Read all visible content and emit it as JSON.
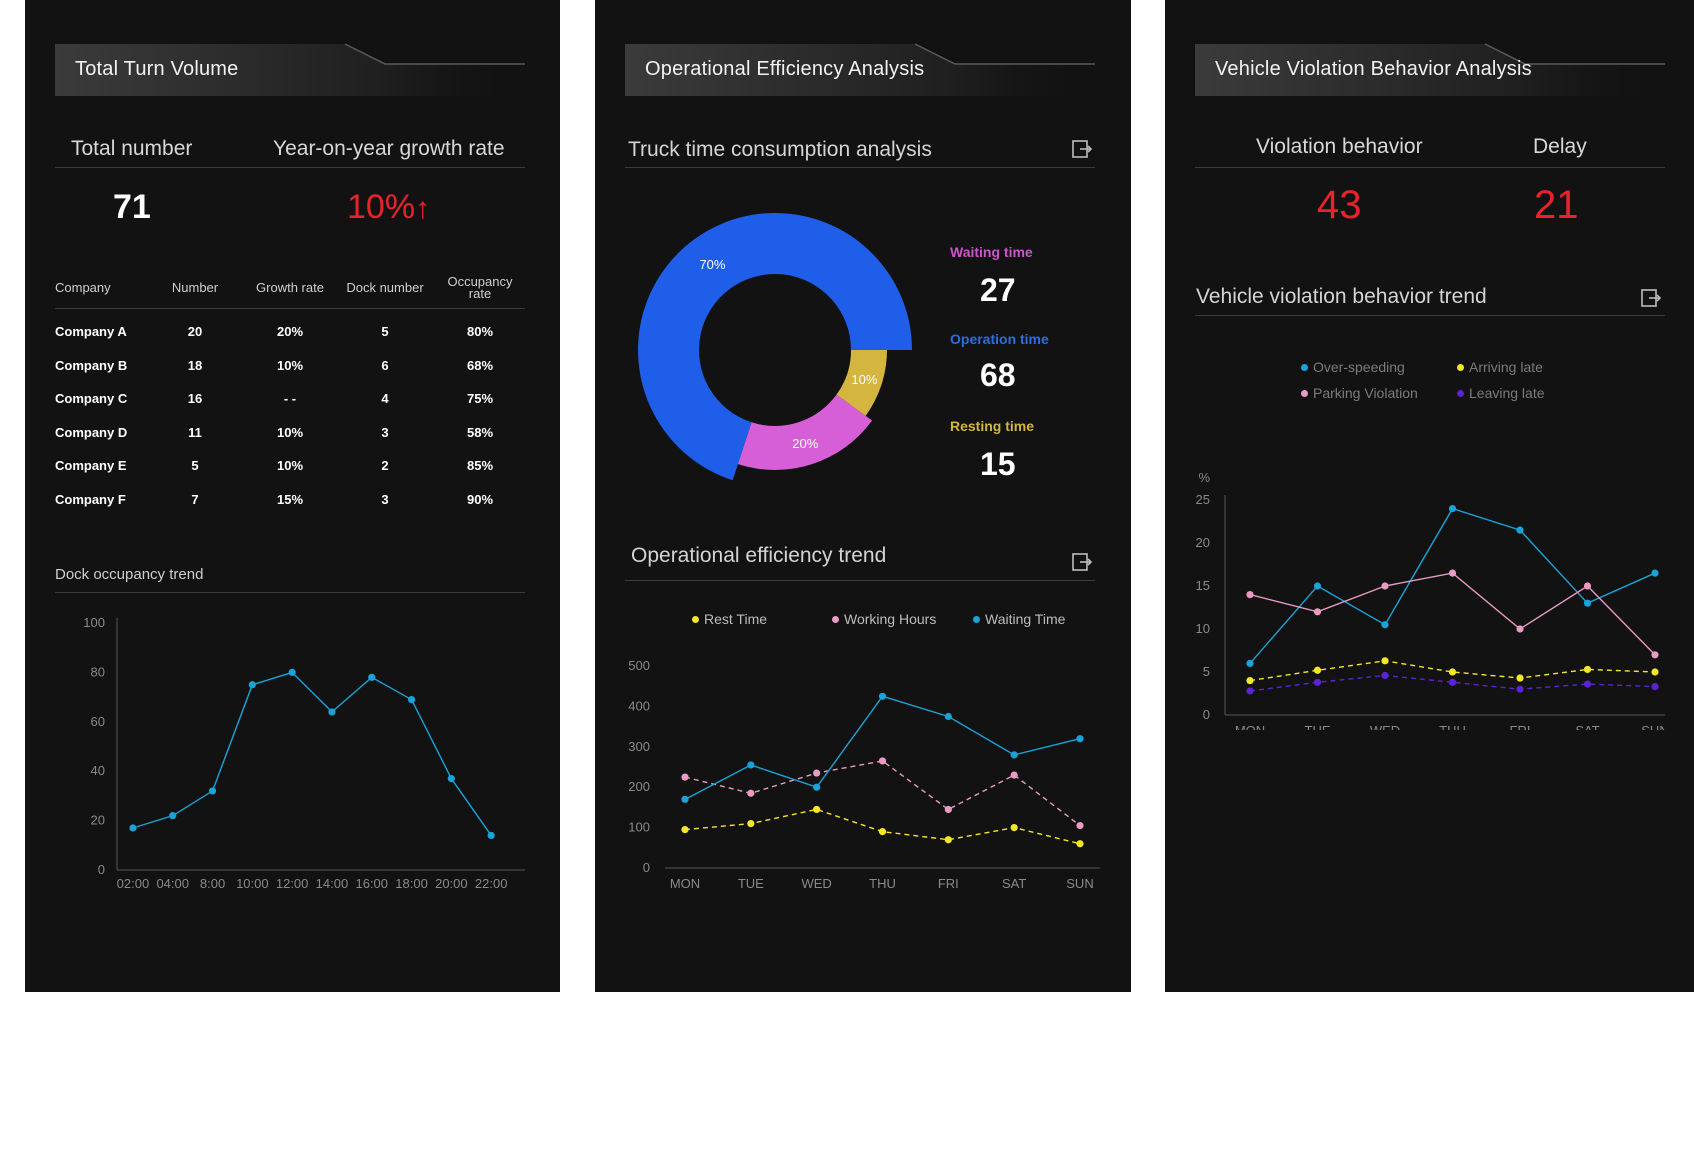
{
  "panel1": {
    "title": "Total Turn Volume",
    "kpi": {
      "total_label": "Total number",
      "total_value": "71",
      "growth_label": "Year-on-year growth rate",
      "growth_value": "10%",
      "growth_arrow": "↑"
    },
    "table": {
      "headers": [
        "Company",
        "Number",
        "Growth rate",
        "Dock number",
        "Occupancy rate"
      ],
      "rows": [
        [
          "Company A",
          "20",
          "20%",
          "5",
          "80%"
        ],
        [
          "Company B",
          "18",
          "10%",
          "6",
          "68%"
        ],
        [
          "Company C",
          "16",
          "- -",
          "4",
          "75%"
        ],
        [
          "Company D",
          "11",
          "10%",
          "3",
          "58%"
        ],
        [
          "Company E",
          "5",
          "10%",
          "2",
          "85%"
        ],
        [
          "Company F",
          "7",
          "15%",
          "3",
          "90%"
        ]
      ]
    },
    "trend_title": "Dock occupancy trend"
  },
  "panel2": {
    "title": "Operational Efficiency Analysis",
    "donut_title": "Truck time consumption analysis",
    "donut_labels": [
      {
        "name": "Waiting time",
        "value": "27",
        "color": "#cc55cc"
      },
      {
        "name": "Operation time",
        "value": "68",
        "color": "#2d6de0"
      },
      {
        "name": "Resting time",
        "value": "15",
        "color": "#d4b540"
      }
    ],
    "trend_title": "Operational efficiency trend",
    "legend": [
      {
        "name": "Rest Time",
        "color": "#f5e62a"
      },
      {
        "name": "Working Hours",
        "color": "#e99bc4"
      },
      {
        "name": "Waiting Time",
        "color": "#1aa3d8"
      }
    ]
  },
  "panel3": {
    "title": "Vehicle Violation Behavior Analysis",
    "kpi": {
      "violation_label": "Violation behavior",
      "violation_value": "43",
      "delay_label": "Delay",
      "delay_value": "21"
    },
    "trend_title": "Vehicle violation behavior trend",
    "legend": [
      {
        "name": "Over-speeding",
        "color": "#1aa3d8"
      },
      {
        "name": "Arriving late",
        "color": "#f5e62a"
      },
      {
        "name": "Parking Violation",
        "color": "#e99bc4"
      },
      {
        "name": "Leaving late",
        "color": "#5b23d6"
      }
    ]
  },
  "colors": {
    "panel_bg": "#121212",
    "accent_red": "#e8232b",
    "line_blue": "#1aa3d8",
    "line_pink": "#e99bc4",
    "line_yellow": "#f5e62a",
    "line_purple": "#5b23d6"
  },
  "chart_data": [
    {
      "id": "dock-occupancy",
      "type": "line",
      "title": "Dock occupancy trend",
      "x": [
        "02:00",
        "04:00",
        "8:00",
        "10:00",
        "12:00",
        "14:00",
        "16:00",
        "18:00",
        "20:00",
        "22:00"
      ],
      "series": [
        {
          "color": "#1aa3d8",
          "points": [
            [
              1,
              17
            ],
            [
              2,
              22
            ],
            [
              3,
              32
            ],
            [
              4,
              75
            ],
            [
              5,
              80
            ],
            [
              6,
              64
            ],
            [
              7,
              78
            ],
            [
              8,
              69
            ],
            [
              9,
              37
            ],
            [
              10,
              14
            ]
          ]
        }
      ],
      "ylim": [
        0,
        100
      ],
      "yticks": [
        0,
        20,
        40,
        60,
        80,
        100
      ],
      "xticks": [
        1,
        2,
        3,
        4,
        5,
        6,
        7,
        8,
        9,
        10
      ],
      "xlim": [
        0.6,
        10.9
      ]
    },
    {
      "id": "truck-time",
      "type": "pie",
      "title": "Truck time consumption analysis",
      "slices": [
        {
          "label": "70%",
          "value": 70,
          "color": "#1f5ee8"
        },
        {
          "label": "10%",
          "value": 10,
          "color": "#d4b540"
        },
        {
          "label": "20%",
          "value": 20,
          "color": "#d65ed6"
        }
      ]
    },
    {
      "id": "efficiency-trend",
      "type": "line",
      "title": "Operational efficiency trend",
      "x": [
        "MON",
        "TUE",
        "WED",
        "THU",
        "FRI",
        "SAT",
        "SUN"
      ],
      "series": [
        {
          "name": "Rest Time",
          "color": "#f5e62a",
          "dashed": true,
          "values": [
            95,
            110,
            145,
            90,
            70,
            100,
            60
          ]
        },
        {
          "name": "Working Hours",
          "color": "#e99bc4",
          "dashed": true,
          "values": [
            225,
            185,
            235,
            265,
            145,
            230,
            105
          ]
        },
        {
          "name": "Waiting Time",
          "color": "#1aa3d8",
          "dashed": false,
          "values": [
            170,
            255,
            200,
            425,
            375,
            280,
            320
          ]
        }
      ],
      "ylim": [
        0,
        500
      ],
      "yticks": [
        0,
        100,
        200,
        300,
        400,
        500
      ]
    },
    {
      "id": "violation-trend",
      "type": "line",
      "title": "Vehicle violation behavior trend",
      "ylabel": "%",
      "x": [
        "MON",
        "TUE",
        "WED",
        "THU",
        "FRI",
        "SAT",
        "SUN"
      ],
      "series": [
        {
          "name": "Over-speeding",
          "color": "#1aa3d8",
          "dashed": false,
          "values": [
            6,
            15,
            10.5,
            24,
            21.5,
            13,
            16.5
          ]
        },
        {
          "name": "Parking Violation",
          "color": "#e99bc4",
          "dashed": false,
          "values": [
            14,
            12,
            15,
            16.5,
            10,
            15,
            7
          ]
        },
        {
          "name": "Arriving late",
          "color": "#f5e62a",
          "dashed": true,
          "values": [
            4,
            5.2,
            6.3,
            5,
            4.3,
            5.3,
            5
          ]
        },
        {
          "name": "Leaving late",
          "color": "#5b23d6",
          "dashed": true,
          "values": [
            2.8,
            3.8,
            4.6,
            3.8,
            3,
            3.6,
            3.3
          ]
        }
      ],
      "ylim": [
        0,
        25
      ],
      "yticks": [
        0,
        5,
        10,
        15,
        20,
        25
      ]
    }
  ]
}
